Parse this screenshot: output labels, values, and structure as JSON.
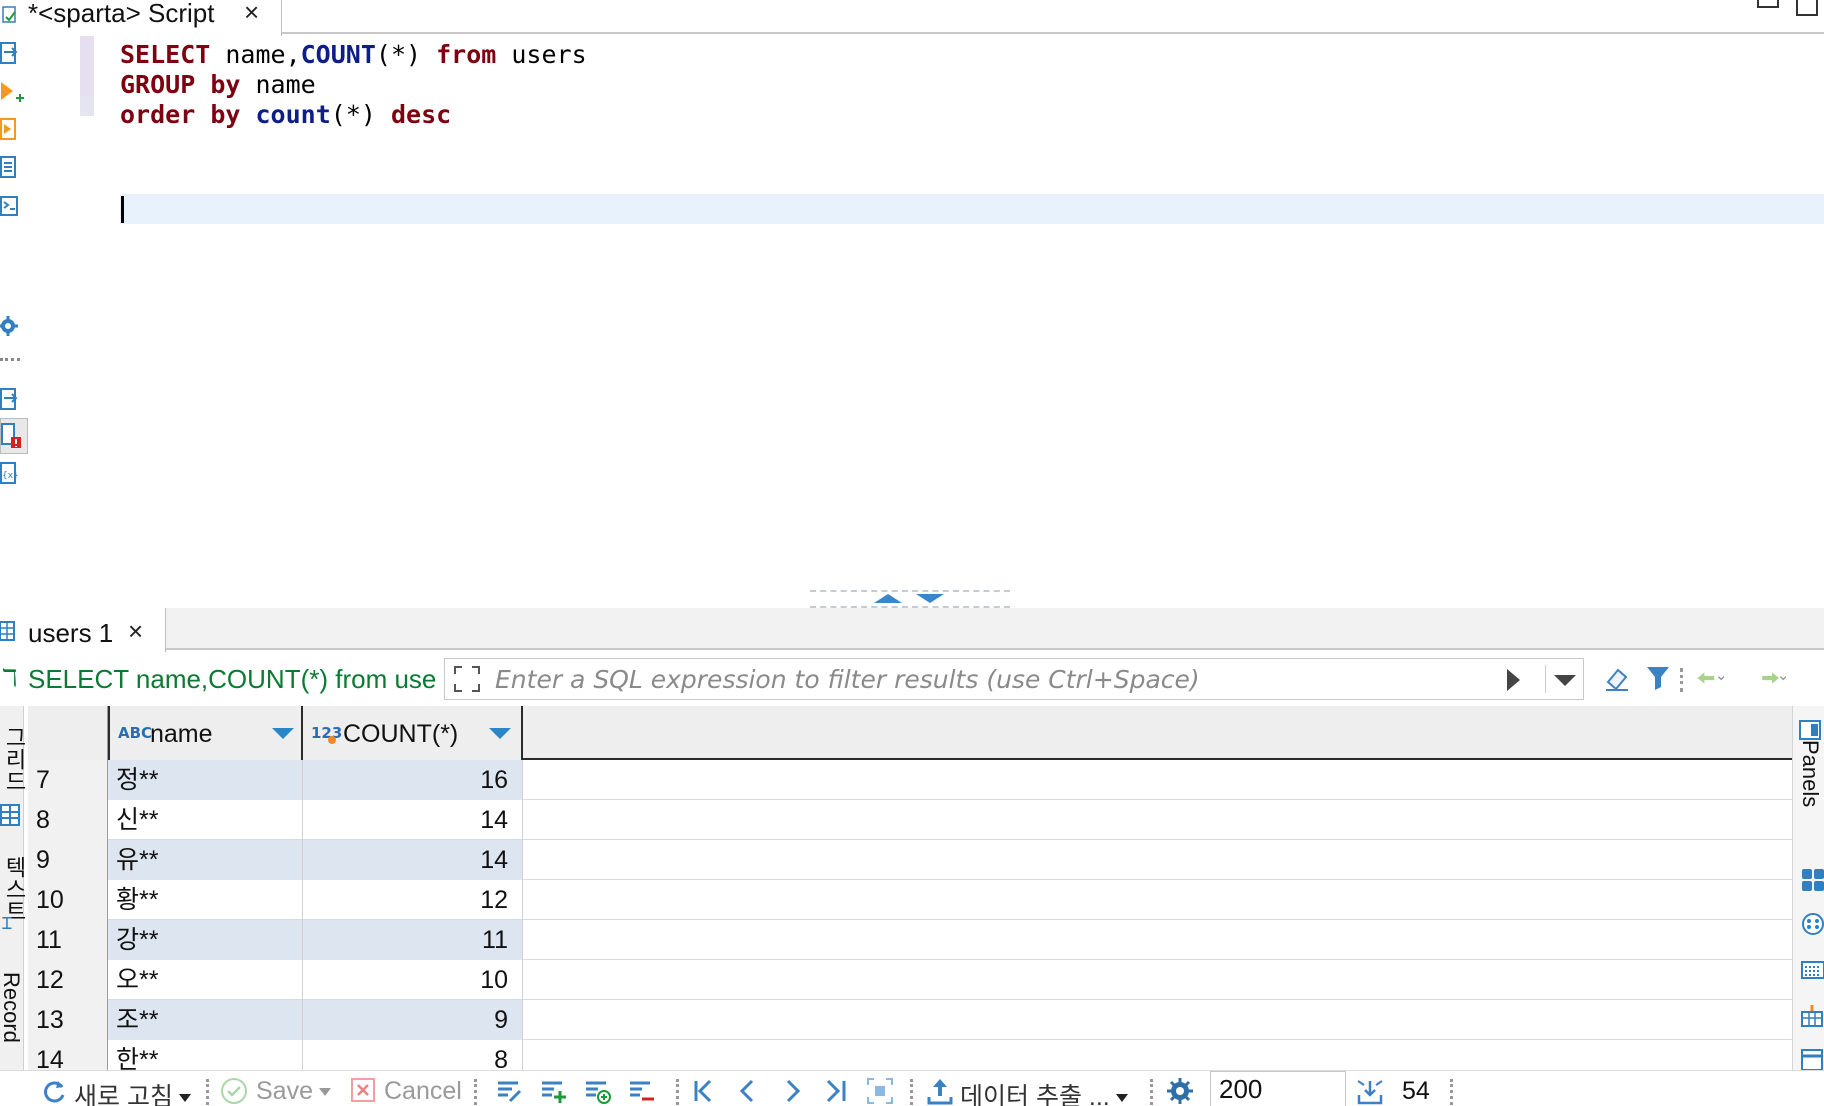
{
  "editor_tab": {
    "title": "*<sparta> Script",
    "close": "×"
  },
  "code": {
    "line1": {
      "kw_select": "SELECT",
      "t1": " name,",
      "fn_count": "COUNT",
      "t2": "(*) ",
      "kw_from": "from",
      "t3": " users"
    },
    "line2": {
      "kw_group": "GROUP",
      "kw_by": "by",
      "t4": " name"
    },
    "line3": {
      "kw_order": "order",
      "kw_by2": "by",
      "fn_count2": "count",
      "t5": "(*) ",
      "kw_desc": "desc"
    }
  },
  "results_tab": {
    "title": "users 1",
    "close": "×"
  },
  "filter": {
    "query_text": "SELECT name,COUNT(*) from users",
    "placeholder": "Enter a SQL expression to filter results (use Ctrl+Space)"
  },
  "grid": {
    "columns": [
      {
        "label": "name",
        "type_badge": "ABC"
      },
      {
        "label": "COUNT(*)",
        "type_badge": "123"
      }
    ],
    "rows": [
      {
        "num": "7",
        "name": "정**",
        "count": "16"
      },
      {
        "num": "8",
        "name": "신**",
        "count": "14"
      },
      {
        "num": "9",
        "name": "유**",
        "count": "14"
      },
      {
        "num": "10",
        "name": "황**",
        "count": "12"
      },
      {
        "num": "11",
        "name": "강**",
        "count": "11"
      },
      {
        "num": "12",
        "name": "오**",
        "count": "10"
      },
      {
        "num": "13",
        "name": "조**",
        "count": "9"
      },
      {
        "num": "14",
        "name": "한**",
        "count": "8"
      }
    ]
  },
  "side_tabs": {
    "grid": "그리드",
    "text": "텍스트",
    "record": "Record",
    "panels": "Panels"
  },
  "bottom_toolbar": {
    "refresh": "새로 고침",
    "save": "Save",
    "cancel": "Cancel",
    "export": "데이터 추출 ...",
    "fetch_size": "200",
    "row_count": "54"
  },
  "colors": {
    "keyword": "#7f0010",
    "function": "#0d1d8a",
    "query_text": "#0a7a33",
    "accent": "#2b86c8",
    "alt_row": "#dde6f0"
  }
}
